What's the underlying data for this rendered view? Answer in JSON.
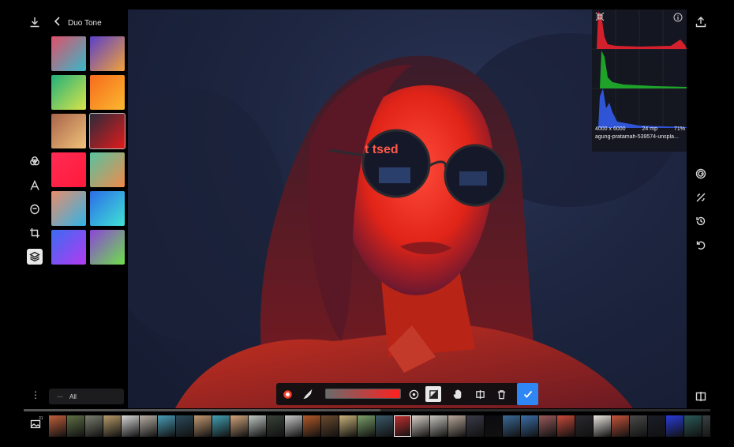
{
  "panel": {
    "title": "Duo Tone",
    "all_label": "All",
    "more_label": "⋮",
    "all_dots": "···"
  },
  "swatches": [
    {
      "name": "swatch-1",
      "from": "#e0506a",
      "to": "#36b9c9"
    },
    {
      "name": "swatch-2",
      "from": "#5a3fc9",
      "to": "#f2a23a"
    },
    {
      "name": "swatch-3",
      "from": "#22b07a",
      "to": "#d9e44a"
    },
    {
      "name": "swatch-4",
      "from": "#f76b1c",
      "to": "#fbb830"
    },
    {
      "name": "swatch-5",
      "from": "#a8644a",
      "to": "#f1c27a"
    },
    {
      "name": "swatch-6",
      "from": "#2b2b3a",
      "to": "#e21b1b",
      "selected": true
    },
    {
      "name": "swatch-7",
      "from": "#ff2b55",
      "to": "#ff1a3a"
    },
    {
      "name": "swatch-8",
      "from": "#57c3a0",
      "to": "#f08a4b"
    },
    {
      "name": "swatch-9",
      "from": "#ea8d6b",
      "to": "#2fb4e8"
    },
    {
      "name": "swatch-10",
      "from": "#2b6de8",
      "to": "#40e3d5"
    },
    {
      "name": "swatch-11",
      "from": "#3b6cf2",
      "to": "#b43af0"
    },
    {
      "name": "swatch-12",
      "from": "#8b45d8",
      "to": "#6ee04a"
    }
  ],
  "histogram": {
    "dimensions": "4000 x 6000",
    "megapixels": "24 mp",
    "zoom": "71%",
    "filename": "agung-pratamah-539574-unspla...",
    "colors": {
      "red": "#d2202c",
      "green": "#1fa22a",
      "blue": "#2f55d6"
    }
  },
  "toolbar": {
    "slider_from": "#6b6b6b",
    "slider_to": "#ff1f1f",
    "confirm_color": "#2f86f5"
  },
  "filmstrip": {
    "progress": 0.52,
    "count_label": "31",
    "thumbs": [
      "#c0603a",
      "#5e7046",
      "#7a7f6e",
      "#b79c6b",
      "#d8d8d8",
      "#b8b0a6",
      "#4a9eb8",
      "#2b4a5a",
      "#c39a72",
      "#43a0b3",
      "#d0a47c",
      "#bfc8c3",
      "#394238",
      "#c8c8c8",
      "#b35a2a",
      "#6b4a2e",
      "#c8b27a",
      "#7ba06a",
      "#3a5a6a",
      "#c33030",
      "#d8d0c8",
      "#c6c4bd",
      "#b8a89a",
      "#3a3a48",
      "#0b0b10",
      "#3a6a98",
      "#3b6ea8",
      "#9a5a5a",
      "#c84a3a",
      "#2a2a30",
      "#eae5e0",
      "#c4543a",
      "#4a4a4a",
      "#1b1d28",
      "#2a3cd8",
      "#2a5a58",
      "#3a4040"
    ],
    "active_index": 19
  }
}
